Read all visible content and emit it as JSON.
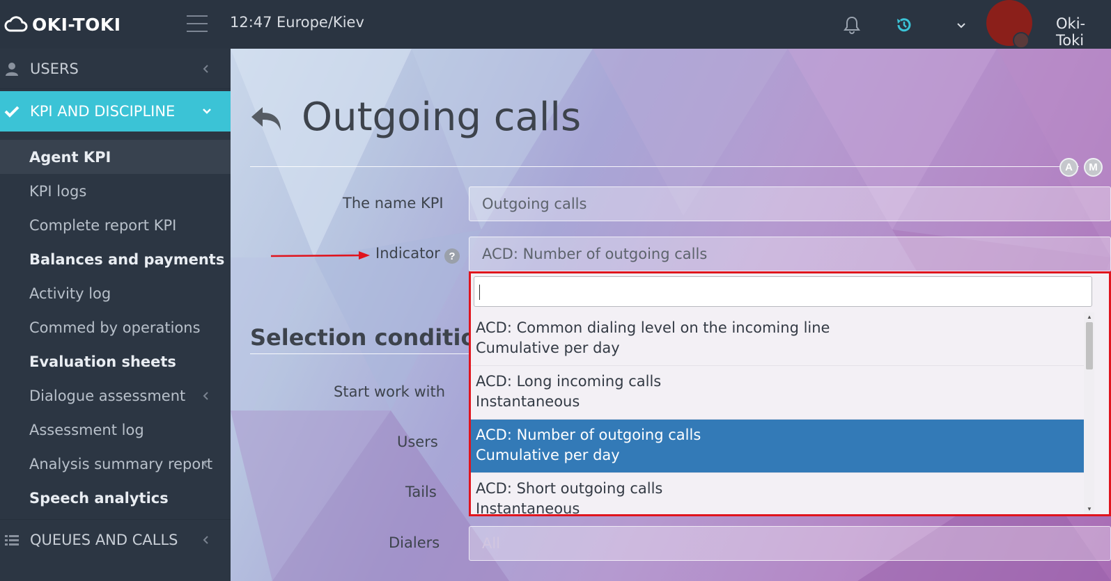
{
  "topbar": {
    "logo_text": "OKI-TOKI",
    "time": "12:47",
    "timezone": "Europe/Kiev",
    "username": "Oki-Toki"
  },
  "sidebar": {
    "users": "USERS",
    "kpi": "KPI AND DISCIPLINE",
    "items": [
      {
        "label": "Agent KPI"
      },
      {
        "label": "KPI logs"
      },
      {
        "label": "Complete report KPI"
      },
      {
        "label": "Balances and payments"
      },
      {
        "label": "Activity log"
      },
      {
        "label": "Commed by operations"
      },
      {
        "label": "Evaluation sheets"
      },
      {
        "label": "Dialogue assessment"
      },
      {
        "label": "Assessment log"
      },
      {
        "label": "Analysis summary report"
      },
      {
        "label": "Speech analytics"
      }
    ],
    "queues": "QUEUES AND CALLS"
  },
  "main": {
    "title": "Outgoing calls",
    "badges": [
      "A",
      "M"
    ],
    "form": {
      "name_label": "The name KPI",
      "name_value": "Outgoing calls",
      "indicator_label": "Indicator",
      "indicator_value": "ACD: Number of outgoing calls",
      "help": "?",
      "section_title": "Selection conditions",
      "start_label": "Start work with",
      "users_label": "Users",
      "tails_label": "Tails",
      "dialers_label": "Dialers",
      "dialers_placeholder": "All"
    },
    "dropdown": {
      "options": [
        {
          "line1": "ACD: Common dialing level on the incoming line",
          "line2": "Cumulative per day",
          "selected": false
        },
        {
          "line1": "ACD: Long incoming calls",
          "line2": "Instantaneous",
          "selected": false
        },
        {
          "line1": "ACD: Number of outgoing calls",
          "line2": "Cumulative per day",
          "selected": true
        },
        {
          "line1": "ACD: Short outgoing calls",
          "line2": "Instantaneous",
          "selected": false
        }
      ]
    }
  },
  "colors": {
    "accent": "#3bc3d6",
    "selected": "#337ab7",
    "highlight_border": "#e0141d",
    "topbar": "#2a3441"
  }
}
